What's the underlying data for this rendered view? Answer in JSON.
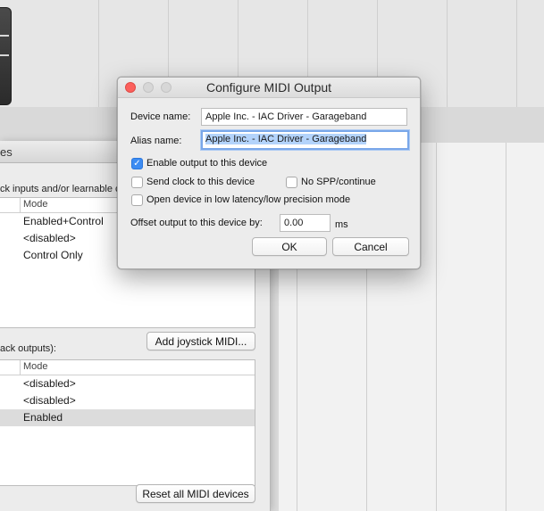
{
  "dialog": {
    "title": "Configure MIDI Output",
    "device_name_label": "Device name:",
    "device_name_value": "Apple Inc. - IAC Driver - Garageband",
    "alias_name_label": "Alias name:",
    "alias_name_value": "Apple Inc. - IAC Driver - Garageband",
    "enable_output_label": "Enable output to this device",
    "enable_output_checked": true,
    "send_clock_label": "Send clock to this device",
    "send_clock_checked": false,
    "no_spp_label": "No SPP/continue",
    "no_spp_checked": false,
    "low_latency_label": "Open device in low latency/low precision mode",
    "low_latency_checked": false,
    "offset_label": "Offset output to this device by:",
    "offset_value": "0.00",
    "offset_unit": "ms",
    "ok_label": "OK",
    "cancel_label": "Cancel"
  },
  "prefs": {
    "title_fragment": "es",
    "inputs_caption_fragment": "ck inputs and/or learnable c",
    "inputs_table": {
      "column_header": "Mode",
      "rows": [
        "Enabled+Control",
        "<disabled>",
        "Control Only"
      ]
    },
    "outputs_caption_fragment": "ack outputs):",
    "add_joystick_label": "Add joystick MIDI...",
    "outputs_table": {
      "column_header": "Mode",
      "rows": [
        "<disabled>",
        "<disabled>",
        "Enabled"
      ],
      "selected_row": 2
    },
    "reset_label": "Reset all MIDI devices"
  },
  "colors": {
    "accent": "#3d8cf2",
    "close_light": "#fc605c",
    "selection_highlight": "#b3d3fb"
  }
}
